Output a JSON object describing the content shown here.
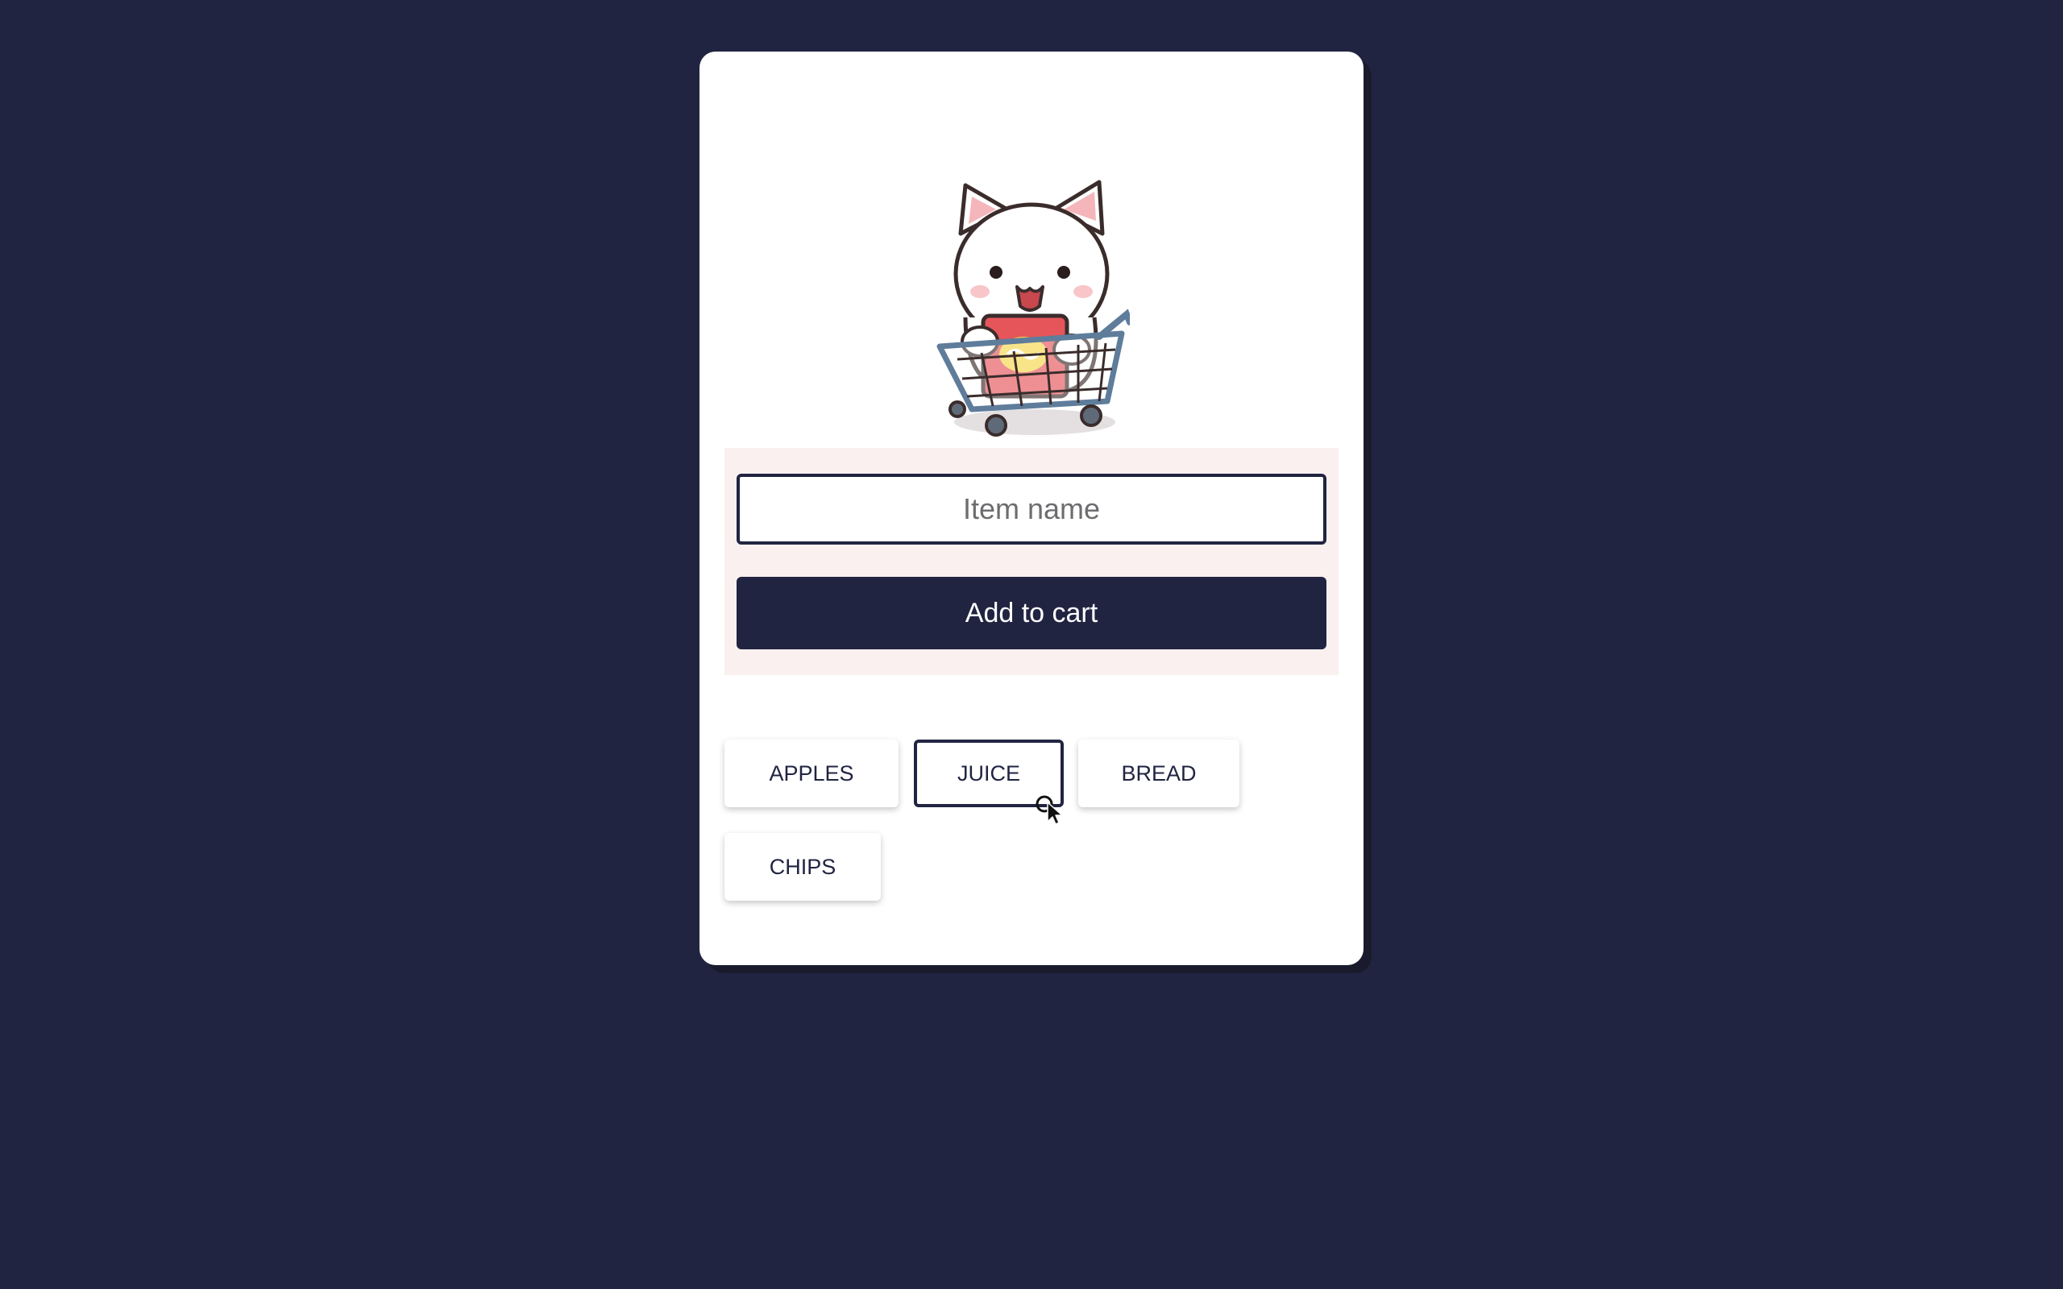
{
  "form": {
    "input_placeholder": "Item name",
    "input_value": "",
    "add_button_label": "Add to cart"
  },
  "hero_image": {
    "icon": "cat-in-shopping-cart-icon"
  },
  "items": [
    {
      "label": "APPLES"
    },
    {
      "label": "JUICE"
    },
    {
      "label": "BREAD"
    },
    {
      "label": "CHIPS"
    }
  ],
  "colors": {
    "background": "#212441",
    "card": "#ffffff",
    "form_panel": "#faf0f0",
    "accent": "#212441",
    "button_text": "#ffffff"
  }
}
